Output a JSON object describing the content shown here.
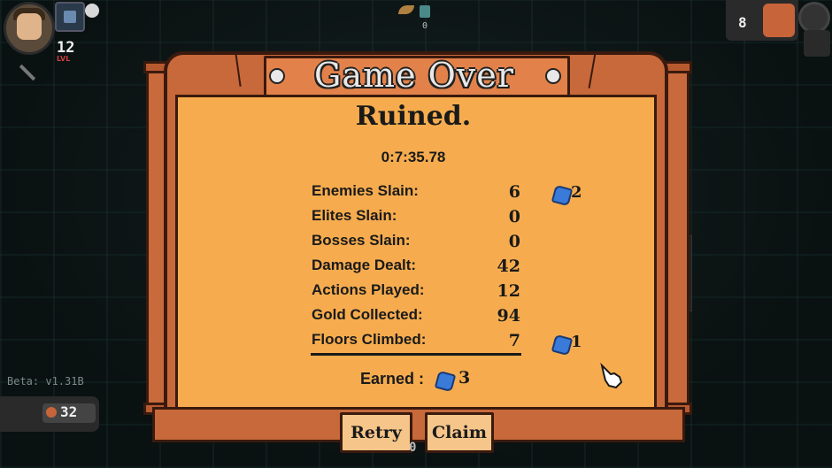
{
  "hud": {
    "level": "12",
    "level_sub": "LVL",
    "top_counter": "0",
    "right_count": "8",
    "version": "Beta: v1.31B",
    "gold": "32",
    "bottom_counter": "0"
  },
  "panel": {
    "title": "Game Over",
    "heading": "Ruined.",
    "time": "0:7:35.78",
    "stats": [
      {
        "label": "Enemies Slain:",
        "value": "6",
        "bonus": "2"
      },
      {
        "label": "Elites Slain:",
        "value": "0",
        "bonus": ""
      },
      {
        "label": "Bosses Slain:",
        "value": "0",
        "bonus": ""
      },
      {
        "label": "Damage Dealt:",
        "value": "42",
        "bonus": ""
      },
      {
        "label": "Actions Played:",
        "value": "12",
        "bonus": ""
      },
      {
        "label": "Gold Collected:",
        "value": "94",
        "bonus": ""
      },
      {
        "label": "Floors Climbed:",
        "value": "7",
        "bonus": "1"
      }
    ],
    "earned_label": "Earned :",
    "earned_value": "3",
    "buttons": {
      "retry": "Retry",
      "claim": "Claim"
    }
  },
  "colors": {
    "frame": "#c8693b",
    "inner": "#f6ac4e",
    "gem": "#3a7ad8"
  }
}
